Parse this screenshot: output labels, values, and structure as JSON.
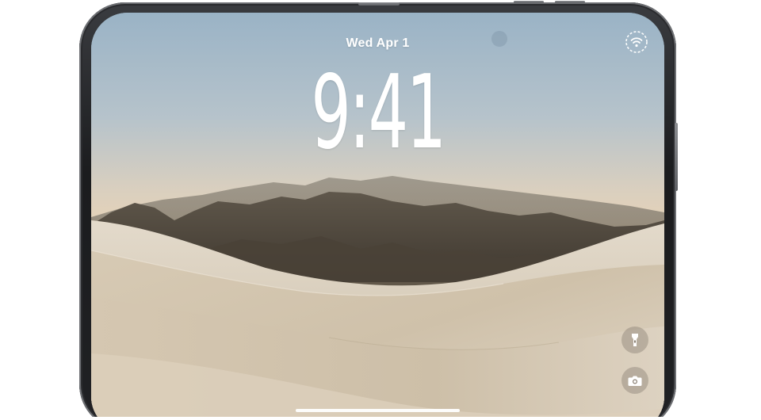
{
  "lock_screen": {
    "date": "Wed Apr 1",
    "time": "9:41"
  },
  "status": {
    "icon": "wifi-signal-icon"
  },
  "quick_actions": [
    {
      "name": "flashlight",
      "icon": "flashlight-icon"
    },
    {
      "name": "camera",
      "icon": "camera-icon"
    }
  ],
  "wallpaper": {
    "scene": "mountains-and-sand-dunes"
  },
  "colors": {
    "text": "#ffffff",
    "frame": "#1e1f21",
    "sky_top": "#9cb6c8",
    "sand": "#d8cdbb"
  }
}
